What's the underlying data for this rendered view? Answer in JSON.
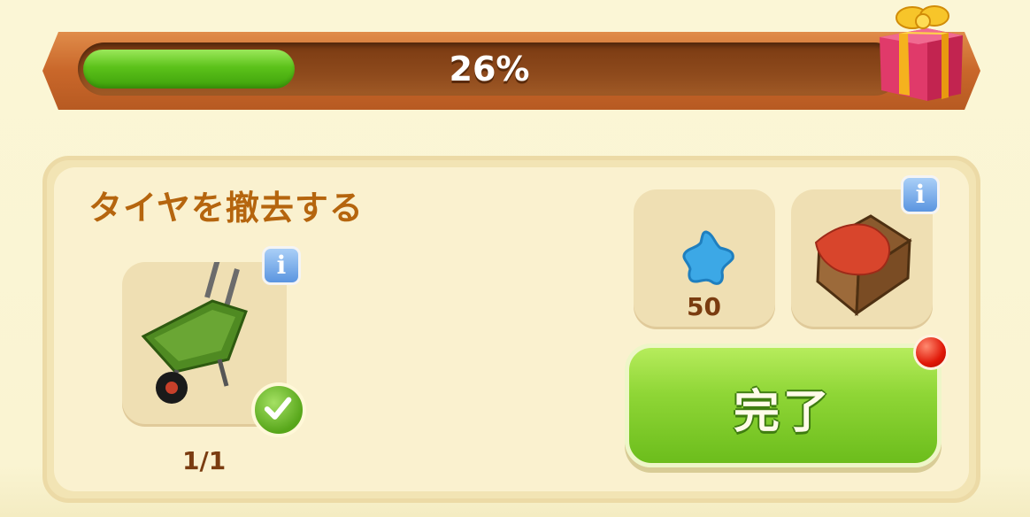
{
  "progress": {
    "percent": 0.26,
    "label": "26%"
  },
  "task": {
    "title": "タイヤを撤去する",
    "requirement": {
      "item": "wheelbarrow-icon",
      "count_label": "1/1",
      "completed": true
    },
    "rewards": [
      {
        "icon": "blue-star-icon",
        "amount": "50"
      },
      {
        "icon": "crate-icon"
      }
    ],
    "complete_button": {
      "label": "完了",
      "notification": true
    }
  },
  "info_label": "i",
  "colors": {
    "accent_green": "#6cbd1c",
    "title": "#b5650e",
    "bar": "#c9672a"
  }
}
